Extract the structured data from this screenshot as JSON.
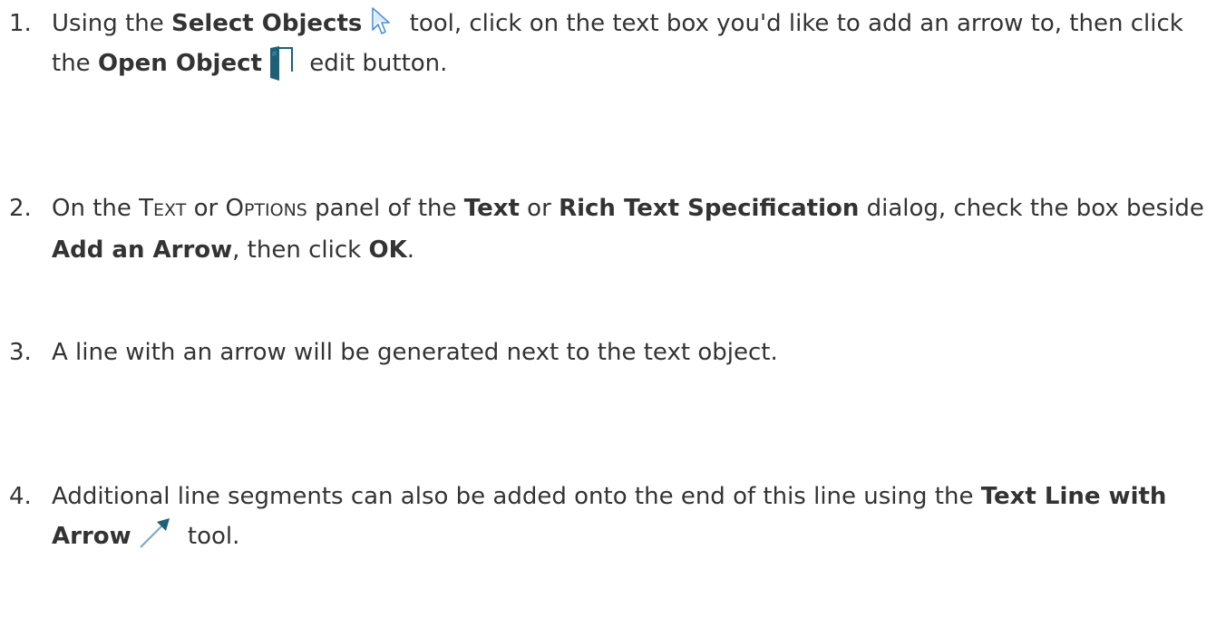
{
  "steps": [
    {
      "number": "1.",
      "t1": "Using the ",
      "b1": "Select Objects",
      "t2": " tool, click on the text box you'd like to add an arrow to, then click the ",
      "b2": "Open Object",
      "t3": " edit button."
    },
    {
      "number": "2.",
      "t1": "On the ",
      "sc1_big": "T",
      "sc1_small": "EXT",
      "t2": " or ",
      "sc2_big": "O",
      "sc2_small": "PTIONS",
      "t3": " panel of the ",
      "b1": "Text",
      "t4": " or ",
      "b2": "Rich Text Specification",
      "t5": " dialog, check the box beside ",
      "b3": "Add an Arrow",
      "t6": ", then click ",
      "b4": "OK",
      "t7": "."
    },
    {
      "number": "3.",
      "t1": "A line with an arrow will be generated next to the text object."
    },
    {
      "number": "4.",
      "t1": "Additional line segments can also be added onto the end of this line using the ",
      "b1": "Text Line with Arrow",
      "t2": " tool."
    }
  ],
  "icons": {
    "select_objects": "select-objects-icon",
    "open_object": "open-object-icon",
    "text_line_with_arrow": "text-line-with-arrow-icon"
  },
  "colors": {
    "text": "#333333",
    "icon_teal": "#1f5f78",
    "icon_light_blue": "#9ec9ea"
  }
}
